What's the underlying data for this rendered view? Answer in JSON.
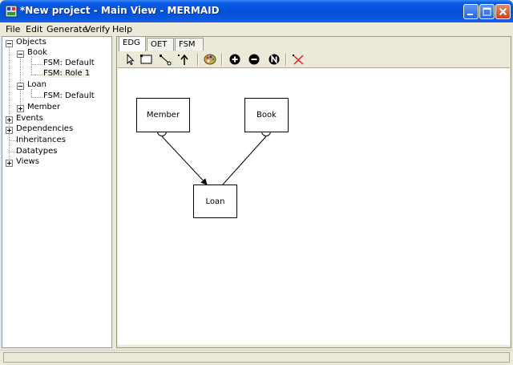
{
  "window": {
    "title": "*New project - Main View - MERMAID"
  },
  "menu": [
    "File",
    "Edit",
    "Generate",
    "Verify",
    "Help"
  ],
  "tree": {
    "items": [
      {
        "label": "Objects",
        "expander": "minus"
      },
      {
        "label": "Book",
        "expander": "minus"
      },
      {
        "label": "FSM: Default",
        "expander": "none"
      },
      {
        "label": "FSM: Role 1",
        "expander": "none",
        "selected": true
      },
      {
        "label": "Loan",
        "expander": "minus"
      },
      {
        "label": "FSM: Default",
        "expander": "none"
      },
      {
        "label": "Member",
        "expander": "plus"
      },
      {
        "label": "Events",
        "expander": "plus"
      },
      {
        "label": "Dependencies",
        "expander": "plus"
      },
      {
        "label": "Inheritances",
        "expander": "none"
      },
      {
        "label": "Datatypes",
        "expander": "none"
      },
      {
        "label": "Views",
        "expander": "plus"
      }
    ]
  },
  "tabs": [
    {
      "label": "EDG",
      "active": true
    },
    {
      "label": "OET",
      "active": false
    },
    {
      "label": "FSM",
      "active": false
    }
  ],
  "toolbar": {
    "icons": [
      "pointer-icon",
      "rectangle-icon",
      "connector-icon",
      "arrow-up-icon",
      "palette-icon",
      "plus-circle-icon",
      "minus-circle-icon",
      "n-circle-icon",
      "delete-x-icon"
    ]
  },
  "diagram": {
    "nodes": [
      "Member",
      "Book",
      "Loan"
    ]
  },
  "colors": {
    "titlebar": "#0a5ce8",
    "panel_border": "#7f9db9",
    "delete_red": "#e02020"
  }
}
